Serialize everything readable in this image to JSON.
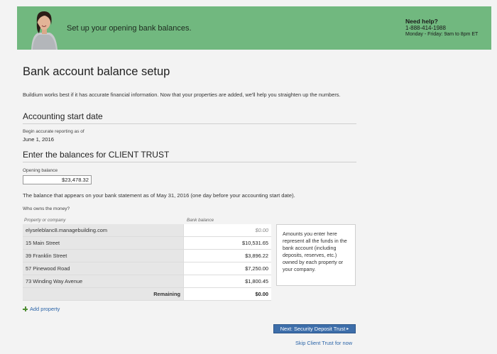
{
  "banner": {
    "message": "Set up your opening bank balances.",
    "help_title": "Need help?",
    "help_phone": "1-888-414-1988",
    "help_hours": "Monday - Friday: 9am to 8pm ET",
    "bg_color": "#71b87f"
  },
  "page": {
    "title": "Bank account balance setup",
    "intro": "Buildium works best if it has accurate financial information. Now that your properties are added, we'll help you straighten up the numbers."
  },
  "accounting": {
    "heading": "Accounting start date",
    "label": "Begin accurate reporting as of",
    "value": "June 1, 2016"
  },
  "balances": {
    "heading": "Enter the balances for CLIENT TRUST",
    "opening_label": "Opening balance",
    "opening_value": "$23,478.32",
    "statement_note": "The balance that appears on your bank statement as of May 31, 2016 (one day before your accounting start date).",
    "who_owns": "Who owns the money?",
    "col_property": "Property or company",
    "col_balance": "Bank balance",
    "rows": [
      {
        "name": "elyseleblanc8.managebuilding.com",
        "amount": "$0.00"
      },
      {
        "name": "15 Main Street",
        "amount": "$10,531.65"
      },
      {
        "name": "39 Franklin Street",
        "amount": "$3,896.22"
      },
      {
        "name": "57 Pinewood Road",
        "amount": "$7,250.00"
      },
      {
        "name": "73 Winding Way Avenue",
        "amount": "$1,800.45"
      }
    ],
    "remaining_label": "Remaining",
    "remaining_value": "$0.00",
    "note": "Amounts you enter here represent all the funds in the bank account (including deposits, reserves, etc.) owned by each property or your company."
  },
  "actions": {
    "add_property": "Add property",
    "next_button": "Next: Security Deposit Trust",
    "skip_link": "Skip Client Trust for now",
    "accent_color": "#3d6eaa"
  }
}
